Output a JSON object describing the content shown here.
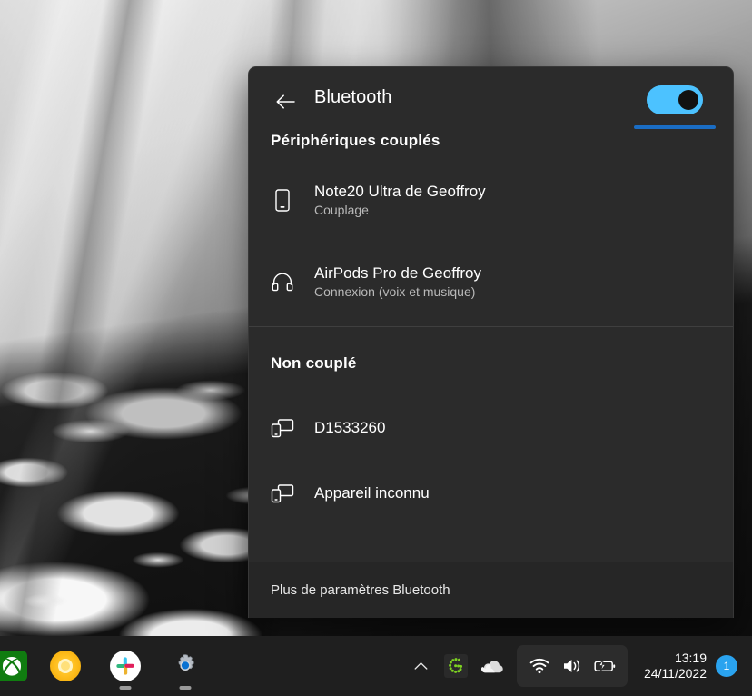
{
  "flyout": {
    "back_icon": "arrow-left-icon",
    "title": "Bluetooth",
    "toggle": {
      "name": "bluetooth-toggle",
      "state": "on",
      "accent_color": "#4cc2ff",
      "underline_color": "#1a6dc4"
    },
    "sections": [
      {
        "heading": "Périphériques couplés",
        "devices": [
          {
            "icon": "phone-icon",
            "name": "Note20 Ultra de Geoffroy",
            "status": "Couplage"
          },
          {
            "icon": "headphones-icon",
            "name": "AirPods Pro de Geoffroy",
            "status": "Connexion (voix et musique)"
          }
        ]
      },
      {
        "heading": "Non couplé",
        "devices": [
          {
            "icon": "devices-icon",
            "name": "D1533260",
            "status": ""
          },
          {
            "icon": "devices-icon",
            "name": "Appareil inconnu",
            "status": ""
          }
        ]
      }
    ],
    "footer_link": "Plus de paramètres Bluetooth",
    "background_color": "#2b2b2b"
  },
  "taskbar": {
    "background_color": "#1f1f1f",
    "apps": [
      {
        "icon": "xbox-icon",
        "label": "Xbox",
        "running": false
      },
      {
        "icon": "canary-icon",
        "label": "Chrome Canary",
        "running": false
      },
      {
        "icon": "slack-icon",
        "label": "Slack",
        "running": true
      },
      {
        "icon": "settings-icon",
        "label": "Paramètres",
        "running": true
      }
    ],
    "tray": {
      "overflow_icon": "chevron-up-icon",
      "items": [
        {
          "icon": "green-g-icon",
          "label": "G"
        },
        {
          "icon": "onedrive-cloud-icon",
          "label": "OneDrive"
        }
      ],
      "pill": [
        {
          "icon": "wifi-icon",
          "label": "Réseau"
        },
        {
          "icon": "volume-icon",
          "label": "Volume"
        },
        {
          "icon": "battery-charging-icon",
          "label": "Batterie"
        }
      ]
    },
    "clock": {
      "time": "13:19",
      "date": "24/11/2022"
    },
    "notification_badge": {
      "count": "1",
      "color": "#2aa3ef"
    }
  }
}
